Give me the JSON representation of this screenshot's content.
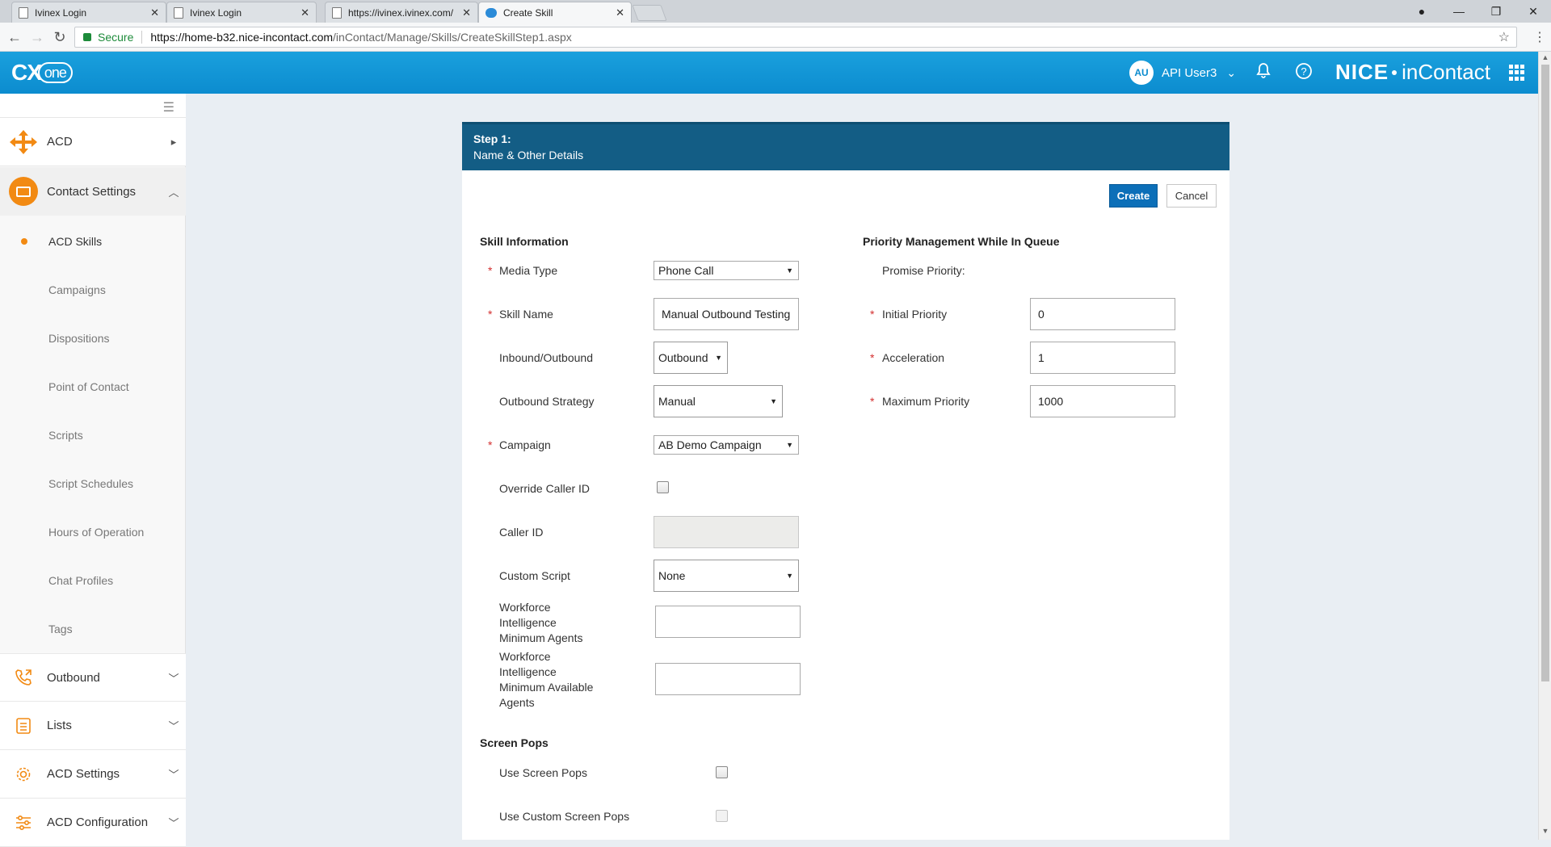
{
  "browser": {
    "tabs": [
      {
        "title": "Ivinex Login"
      },
      {
        "title": "Ivinex Login"
      },
      {
        "title": "https://ivinex.ivinex.com/"
      },
      {
        "title": "Create Skill"
      }
    ],
    "url_secure_label": "Secure",
    "url_host": "https://home-b32.nice-incontact.com",
    "url_path": "/inContact/Manage/Skills/CreateSkillStep1.aspx"
  },
  "header": {
    "logo_text": "CX",
    "logo_sub": "one",
    "user_initials": "AU",
    "user_name": "API User3",
    "brand_nice": "NICE",
    "brand_product": "inContact"
  },
  "sidebar": {
    "top_items": [
      {
        "label": "ACD"
      },
      {
        "label": "Contact Settings"
      }
    ],
    "sub_items": [
      {
        "label": "ACD Skills"
      },
      {
        "label": "Campaigns"
      },
      {
        "label": "Dispositions"
      },
      {
        "label": "Point of Contact"
      },
      {
        "label": "Scripts"
      },
      {
        "label": "Script Schedules"
      },
      {
        "label": "Hours of Operation"
      },
      {
        "label": "Chat Profiles"
      },
      {
        "label": "Tags"
      }
    ],
    "groups": [
      {
        "label": "Outbound"
      },
      {
        "label": "Lists"
      },
      {
        "label": "ACD Settings"
      },
      {
        "label": "ACD Configuration"
      }
    ]
  },
  "card": {
    "step_title": "Step 1:",
    "step_subtitle": "Name & Other Details",
    "create_label": "Create",
    "cancel_label": "Cancel"
  },
  "skill_info": {
    "title": "Skill Information",
    "media_type_label": "Media Type",
    "media_type_value": "Phone Call",
    "skill_name_label": "Skill Name",
    "skill_name_value": "Manual Outbound Testing",
    "direction_label": "Inbound/Outbound",
    "direction_value": "Outbound",
    "strategy_label": "Outbound Strategy",
    "strategy_value": "Manual",
    "campaign_label": "Campaign",
    "campaign_value": "AB Demo Campaign",
    "override_label": "Override Caller ID",
    "caller_id_label": "Caller ID",
    "caller_id_value": "",
    "custom_script_label": "Custom Script",
    "custom_script_value": "None",
    "wi_min_agents_label_1": "Workforce",
    "wi_min_agents_label_2": "Intelligence",
    "wi_min_agents_label_3": "Minimum Agents",
    "wi_min_agents_value": "",
    "wi_min_avail_label_1": "Workforce",
    "wi_min_avail_label_2": "Intelligence",
    "wi_min_avail_label_3": "Minimum Available",
    "wi_min_avail_label_4": "Agents",
    "wi_min_avail_value": ""
  },
  "priority": {
    "title": "Priority Management While In Queue",
    "promise_label": "Promise Priority:",
    "initial_label": "Initial Priority",
    "initial_value": "0",
    "acceleration_label": "Acceleration",
    "acceleration_value": "1",
    "max_label": "Maximum Priority",
    "max_value": "1000"
  },
  "screen_pops": {
    "title": "Screen Pops",
    "use_label": "Use Screen Pops",
    "use_custom_label": "Use Custom Screen Pops"
  },
  "required_mark": "*"
}
